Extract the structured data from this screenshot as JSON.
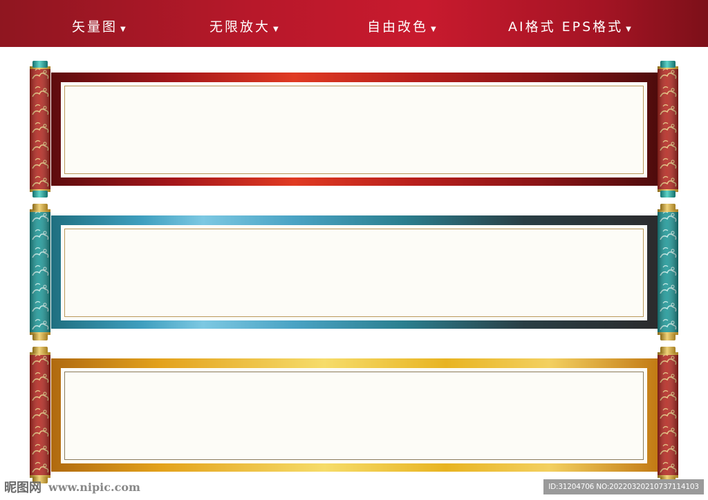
{
  "header": {
    "features": [
      {
        "label": "矢量图"
      },
      {
        "label": "无限放大"
      },
      {
        "label": "自由改色"
      },
      {
        "label": "AI格式 EPS格式"
      }
    ],
    "background_color": "#b7182a"
  },
  "scrolls": [
    {
      "name": "red-scroll",
      "frame_color": "#c0392b",
      "rod_color": "#b3261e"
    },
    {
      "name": "teal-scroll",
      "frame_color": "#4aa3c4",
      "rod_color": "#1f9a9a"
    },
    {
      "name": "gold-scroll",
      "frame_color": "#e8b422",
      "rod_color": "#b3261e"
    }
  ],
  "watermark": {
    "logo": "昵图网",
    "site": "www.nipic.com",
    "id_text": "ID:31204706 NO:20220320210737114103"
  }
}
